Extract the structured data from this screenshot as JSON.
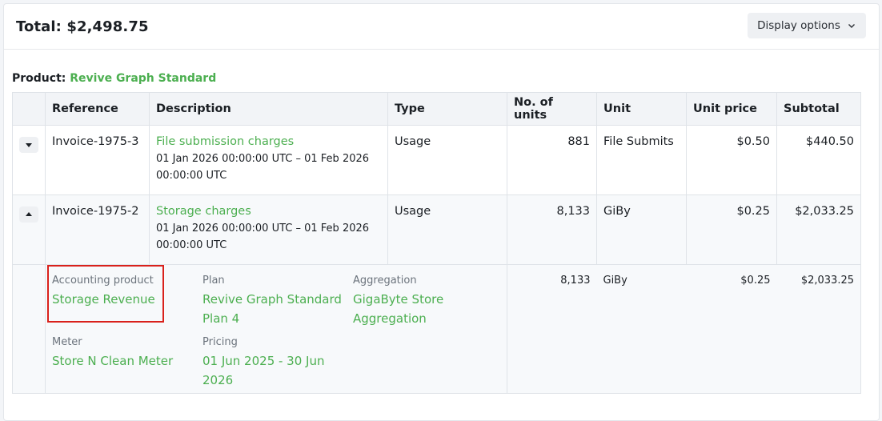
{
  "header": {
    "total": "Total: $2,498.75",
    "display_options": "Display options"
  },
  "product": {
    "label": "Product:",
    "name": "Revive Graph Standard"
  },
  "table": {
    "columns": {
      "reference": "Reference",
      "description": "Description",
      "type": "Type",
      "units": "No. of units",
      "unit": "Unit",
      "unit_price": "Unit price",
      "subtotal": "Subtotal"
    },
    "rows": [
      {
        "reference": "Invoice-1975-3",
        "description": "File submission charges",
        "dates": "01 Jan 2026 00:00:00 UTC – 01 Feb 2026 00:00:00 UTC",
        "type": "Usage",
        "units": "881",
        "unit": "File Submits",
        "unit_price": "$0.50",
        "subtotal": "$440.50"
      },
      {
        "reference": "Invoice-1975-2",
        "description": "Storage charges",
        "dates": "01 Jan 2026 00:00:00 UTC – 01 Feb 2026 00:00:00 UTC",
        "type": "Usage",
        "units": "8,133",
        "unit": "GiBy",
        "unit_price": "$0.25",
        "subtotal": "$2,033.25"
      }
    ],
    "detail": {
      "accounting_product_label": "Accounting product",
      "accounting_product": "Storage Revenue",
      "plan_label": "Plan",
      "plan": "Revive Graph Standard Plan 4",
      "aggregation_label": "Aggregation",
      "aggregation": "GigaByte Store Aggregation",
      "meter_label": "Meter",
      "meter": "Store N Clean Meter",
      "pricing_label": "Pricing",
      "pricing": "01 Jun 2025 - 30 Jun 2026",
      "units": "8,133",
      "unit": "GiBy",
      "unit_price": "$0.25",
      "subtotal": "$2,033.25"
    }
  },
  "colors": {
    "accent_green": "#4caf50",
    "highlight_red": "#d9211b"
  }
}
